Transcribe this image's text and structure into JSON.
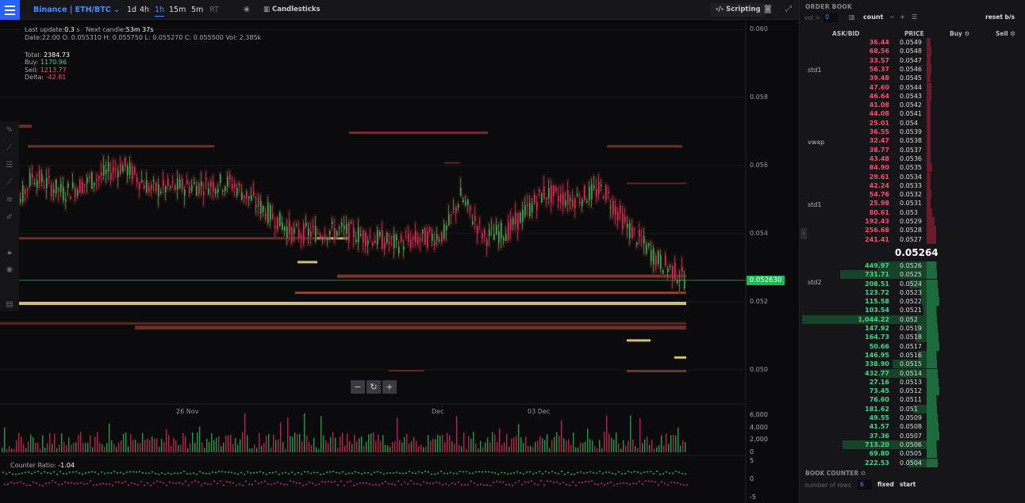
{
  "topbar": {
    "pair": "Binance | ETH/BTC",
    "timeframes": [
      "1d",
      "4h",
      "1h",
      "15m",
      "5m",
      "RT"
    ],
    "candlesticks_label": "Candlesticks",
    "scripting_label": "Scripting"
  },
  "info": {
    "last_update_label": "Last update:",
    "last_update_value": "0.3",
    "last_update_unit": "s",
    "next_candle_label": "Next candle:",
    "next_candle_value": "53m 37s",
    "ohlc_line": "Date:22:00 O: 0.055310 H: 0.055750 L: 0.055270 C: 0.055500 Vol: 2.385k"
  },
  "stats": {
    "total_label": "Total:",
    "total_value": "2384.73",
    "buy_label": "Buy:",
    "buy_value": "1170.96",
    "sell_label": "Sell:",
    "sell_value": "1213.77",
    "delta_label": "Delta:",
    "delta_value": "-42.81"
  },
  "chart": {
    "y_ticks": [
      "0.060",
      "0.058",
      "0.056",
      "0.054",
      "0.052",
      "0.050"
    ],
    "x_ticks": [
      "26 Nov",
      "Dec",
      "03 Dec"
    ],
    "current_price": "0.052630",
    "volume_ticks": [
      "6,000",
      "4,000",
      "2,000",
      "0"
    ],
    "counter_ticks": [
      "5",
      "0",
      "-5"
    ],
    "counter_ratio_label": "Counter Ratio:",
    "counter_ratio_value": "-1.04",
    "colors": {
      "up": "#1db954",
      "down": "#e0245e",
      "heat_low": "#7a2e2e",
      "heat_high": "#e8d27a"
    }
  },
  "orderbook": {
    "title": "ORDER BOOK",
    "vol_label": "vol >",
    "vol_value": "0",
    "count_label": "count",
    "reset_label": "reset b/s",
    "headers": {
      "askbid": "ASK/BID",
      "price": "PRICE",
      "buy": "Buy",
      "sell": "Sell"
    },
    "asks": [
      {
        "qty": "36.44",
        "price": "0.0549"
      },
      {
        "qty": "68.56",
        "price": "0.0548"
      },
      {
        "qty": "33.57",
        "price": "0.0547"
      },
      {
        "qty": "56.37",
        "price": "0.0546"
      },
      {
        "qty": "39.48",
        "price": "0.0545"
      },
      {
        "qty": "47.60",
        "price": "0.0544"
      },
      {
        "qty": "46.64",
        "price": "0.0543"
      },
      {
        "qty": "41.08",
        "price": "0.0542"
      },
      {
        "qty": "44.08",
        "price": "0.0541"
      },
      {
        "qty": "25.01",
        "price": "0.054"
      },
      {
        "qty": "36.55",
        "price": "0.0539"
      },
      {
        "qty": "32.47",
        "price": "0.0538"
      },
      {
        "qty": "38.77",
        "price": "0.0537"
      },
      {
        "qty": "43.48",
        "price": "0.0536"
      },
      {
        "qty": "84.90",
        "price": "0.0535"
      },
      {
        "qty": "29.61",
        "price": "0.0534"
      },
      {
        "qty": "42.24",
        "price": "0.0533"
      },
      {
        "qty": "54.76",
        "price": "0.0532"
      },
      {
        "qty": "25.98",
        "price": "0.0531"
      },
      {
        "qty": "80.61",
        "price": "0.053"
      },
      {
        "qty": "192.43",
        "price": "0.0529"
      },
      {
        "qty": "256.68",
        "price": "0.0528"
      },
      {
        "qty": "241.41",
        "price": "0.0527"
      }
    ],
    "mid_price": "0.05264",
    "bids": [
      {
        "qty": "449.97",
        "price": "0.0526"
      },
      {
        "qty": "731.71",
        "price": "0.0525"
      },
      {
        "qty": "208.51",
        "price": "0.0524"
      },
      {
        "qty": "123.72",
        "price": "0.0523"
      },
      {
        "qty": "115.58",
        "price": "0.0522"
      },
      {
        "qty": "103.54",
        "price": "0.0521"
      },
      {
        "qty": "1,044.22",
        "price": "0.052"
      },
      {
        "qty": "147.92",
        "price": "0.0519"
      },
      {
        "qty": "164.73",
        "price": "0.0518"
      },
      {
        "qty": "50.66",
        "price": "0.0517"
      },
      {
        "qty": "146.95",
        "price": "0.0516"
      },
      {
        "qty": "338.90",
        "price": "0.0515"
      },
      {
        "qty": "432.77",
        "price": "0.0514"
      },
      {
        "qty": "27.16",
        "price": "0.0513"
      },
      {
        "qty": "73.45",
        "price": "0.0512"
      },
      {
        "qty": "76.60",
        "price": "0.0511"
      },
      {
        "qty": "181.62",
        "price": "0.051"
      },
      {
        "qty": "49.55",
        "price": "0.0509"
      },
      {
        "qty": "41.57",
        "price": "0.0508"
      },
      {
        "qty": "37.36",
        "price": "0.0507"
      },
      {
        "qty": "713.20",
        "price": "0.0506"
      },
      {
        "qty": "69.80",
        "price": "0.0505"
      },
      {
        "qty": "222.53",
        "price": "0.0504"
      }
    ],
    "annotations": [
      {
        "label": "std1",
        "price": "0.0546"
      },
      {
        "label": "vwap",
        "price": "0.0538"
      },
      {
        "label": "std1",
        "price": "0.0531"
      },
      {
        "label": "std2",
        "price": "0.0524"
      }
    ],
    "book_counter_title": "BOOK COUNTER",
    "rows_label": "number of rows",
    "rows_value": "6",
    "fixed_label": "fixed",
    "start_label": "start"
  }
}
